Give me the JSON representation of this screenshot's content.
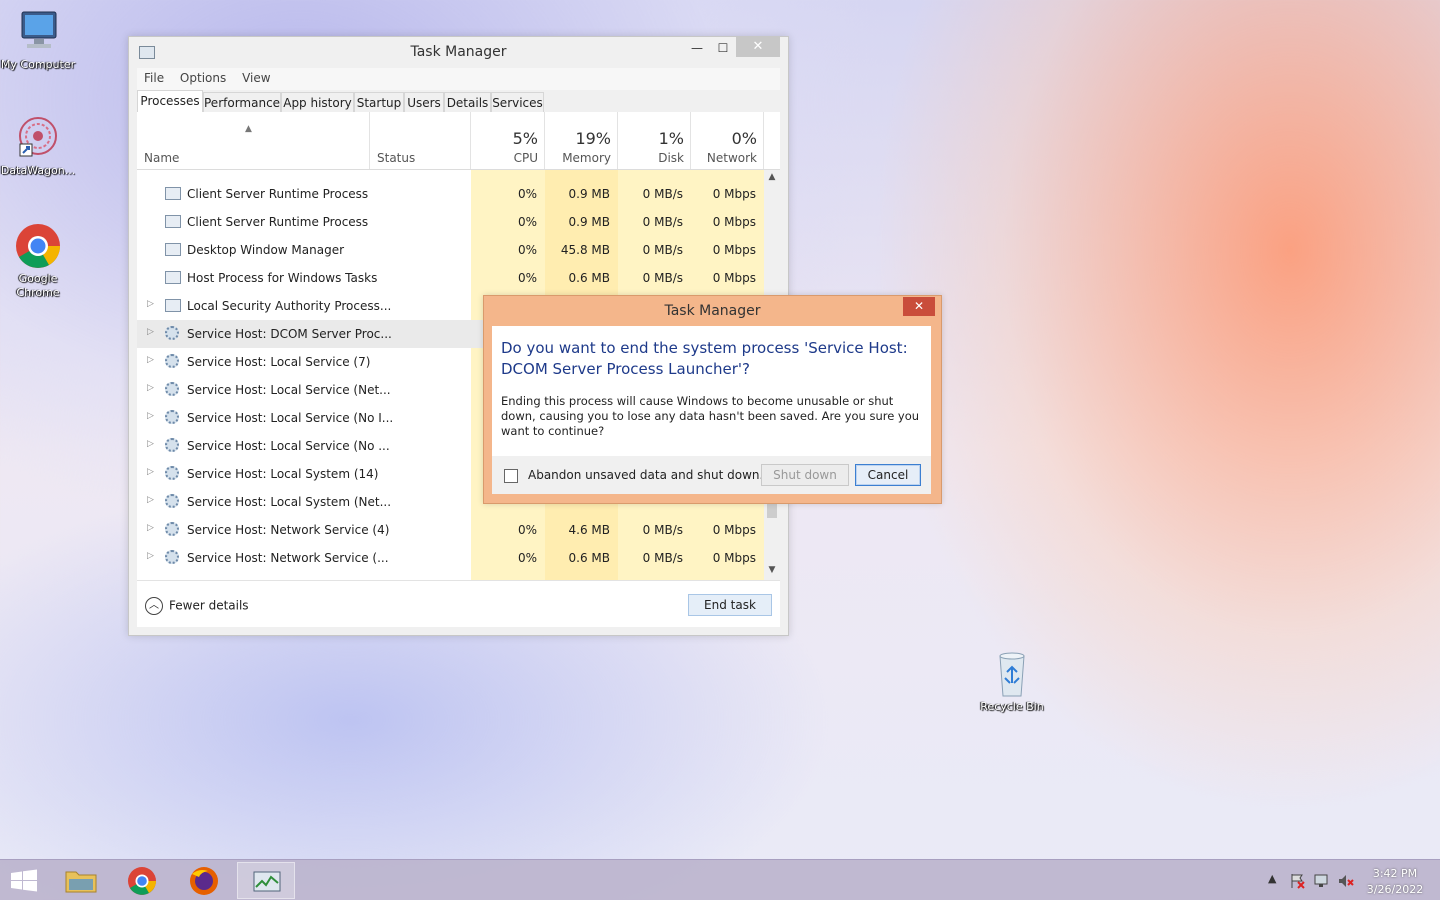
{
  "desktop": {
    "icons": [
      {
        "label": "My Computer"
      },
      {
        "label": "DataWagon..."
      },
      {
        "label": "Google Chrome"
      },
      {
        "label": "Recycle Bin"
      }
    ]
  },
  "task_manager": {
    "title": "Task Manager",
    "controls": {
      "minimize": "—",
      "maximize": "☐",
      "close": "✕"
    },
    "menu": [
      "File",
      "Options",
      "View"
    ],
    "tabs": [
      "Processes",
      "Performance",
      "App history",
      "Startup",
      "Users",
      "Details",
      "Services"
    ],
    "active_tab": "Processes",
    "columns": {
      "name": "Name",
      "status": "Status",
      "cpu": {
        "pct": "5%",
        "label": "CPU"
      },
      "memory": {
        "pct": "19%",
        "label": "Memory"
      },
      "disk": {
        "pct": "1%",
        "label": "Disk"
      },
      "network": {
        "pct": "0%",
        "label": "Network"
      }
    },
    "rows": [
      {
        "name": "Client Server Runtime Process",
        "cpu": "0%",
        "memory": "0.9 MB",
        "disk": "0 MB/s",
        "network": "0 Mbps"
      },
      {
        "name": "Client Server Runtime Process",
        "cpu": "0%",
        "memory": "0.9 MB",
        "disk": "0 MB/s",
        "network": "0 Mbps"
      },
      {
        "name": "Desktop Window Manager",
        "cpu": "0%",
        "memory": "45.8 MB",
        "disk": "0 MB/s",
        "network": "0 Mbps"
      },
      {
        "name": "Host Process for Windows Tasks",
        "cpu": "0%",
        "memory": "0.6 MB",
        "disk": "0 MB/s",
        "network": "0 Mbps"
      },
      {
        "name": "Local Security Authority Process...",
        "cpu": "",
        "memory": "",
        "disk": "",
        "network": ""
      },
      {
        "name": "Service Host: DCOM Server Proc...",
        "cpu": "",
        "memory": "",
        "disk": "",
        "network": ""
      },
      {
        "name": "Service Host: Local Service (7)",
        "cpu": "",
        "memory": "",
        "disk": "",
        "network": ""
      },
      {
        "name": "Service Host: Local Service (Net...",
        "cpu": "",
        "memory": "",
        "disk": "",
        "network": ""
      },
      {
        "name": "Service Host: Local Service (No I...",
        "cpu": "",
        "memory": "",
        "disk": "",
        "network": ""
      },
      {
        "name": "Service Host: Local Service (No ...",
        "cpu": "",
        "memory": "",
        "disk": "",
        "network": ""
      },
      {
        "name": "Service Host: Local System (14)",
        "cpu": "",
        "memory": "",
        "disk": "",
        "network": ""
      },
      {
        "name": "Service Host: Local System (Net...",
        "cpu": "",
        "memory": "",
        "disk": "",
        "network": ""
      },
      {
        "name": "Service Host: Network Service (4)",
        "cpu": "0%",
        "memory": "4.6 MB",
        "disk": "0 MB/s",
        "network": "0 Mbps"
      },
      {
        "name": "Service Host: Network Service (...",
        "cpu": "0%",
        "memory": "0.6 MB",
        "disk": "0 MB/s",
        "network": "0 Mbps"
      }
    ],
    "footer": {
      "fewer_details": "Fewer details",
      "end_task": "End task"
    }
  },
  "dialog": {
    "title": "Task Manager",
    "close": "✕",
    "main_text": "Do you want to end the system process 'Service Host: DCOM Server Process Launcher'?",
    "detail_text": "Ending this process will cause Windows to become unusable or shut down, causing you to lose any data hasn't been saved. Are you sure you want to continue?",
    "checkbox_label": "Abandon unsaved data and shut down.",
    "shutdown_label": "Shut down",
    "cancel_label": "Cancel"
  },
  "taskbar": {
    "clock_time": "3:42 PM",
    "clock_date": "3/26/2022",
    "tray_arrow": "▲"
  }
}
